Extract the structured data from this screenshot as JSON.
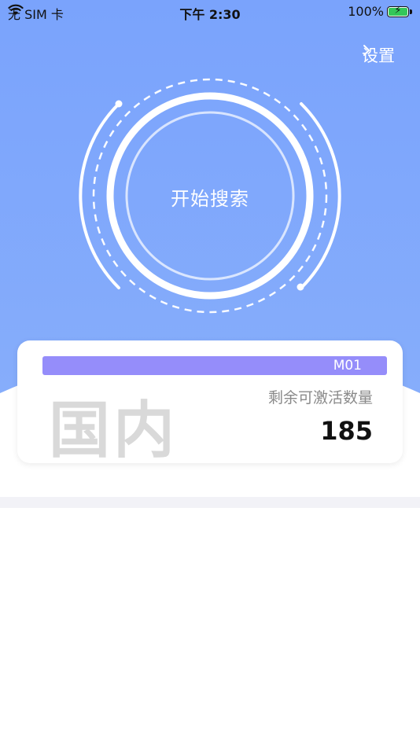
{
  "status_bar": {
    "carrier": "无 SIM 卡",
    "time": "下午 2:30",
    "battery": "100%"
  },
  "header": {
    "settings_label": "设置"
  },
  "search": {
    "label": "开始搜索"
  },
  "card": {
    "device_label": "M01",
    "region": "国内",
    "remaining_label": "剩余可激活数量",
    "remaining_count": "185"
  },
  "colors": {
    "hero_top": "#7aa3fc",
    "hero_bottom": "#84acfb",
    "card_bar": "#958dfa",
    "divider": "#f2f2f7"
  },
  "icons": [
    "wifi-icon",
    "battery-charging-icon",
    "chevron-right-icon"
  ]
}
